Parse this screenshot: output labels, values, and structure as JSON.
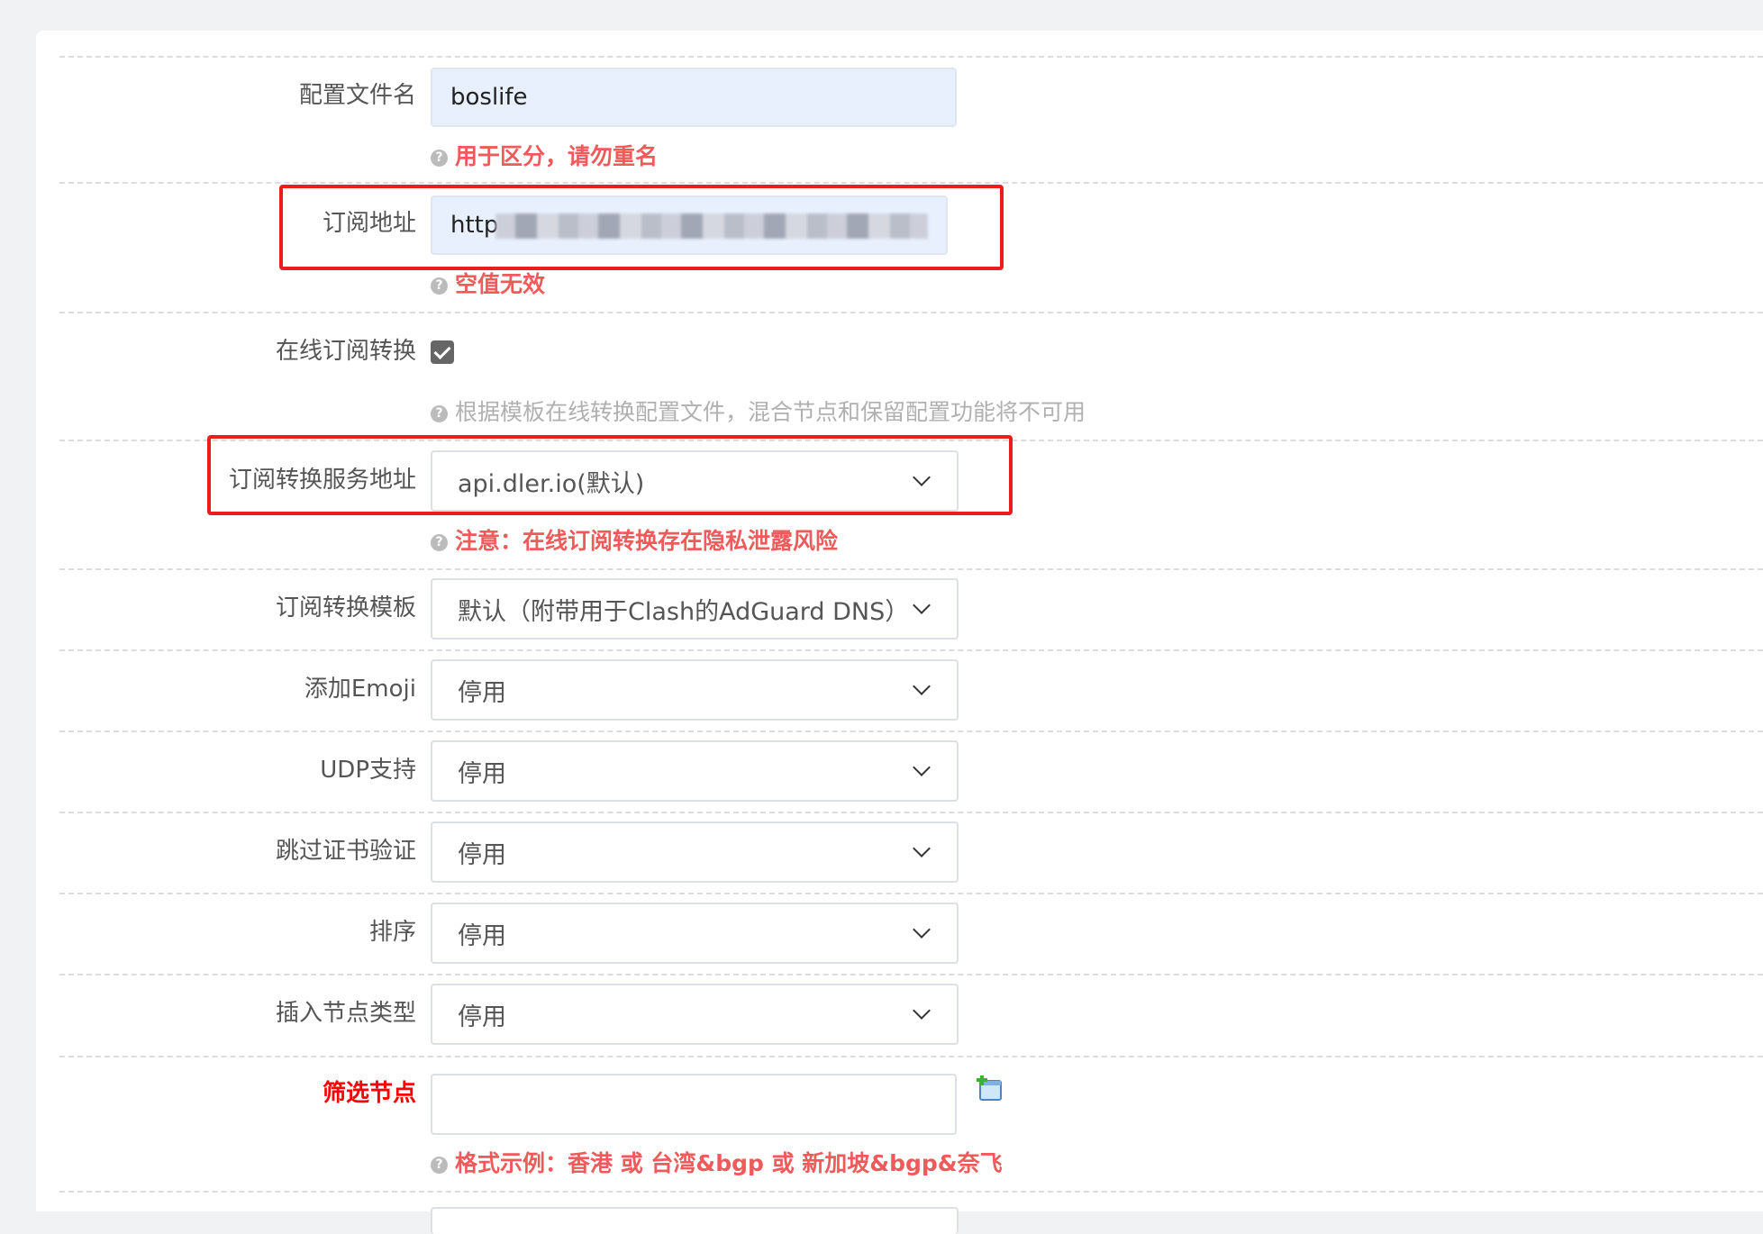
{
  "top_strip_text": "",
  "form": {
    "config_name": {
      "label": "配置文件名",
      "value": "boslife",
      "hint": "用于区分，请勿重名"
    },
    "sub_url": {
      "label": "订阅地址",
      "value": "http",
      "hint": "空值无效"
    },
    "online_convert": {
      "label": "在线订阅转换",
      "checked": true,
      "hint": "根据模板在线转换配置文件，混合节点和保留配置功能将不可用"
    },
    "convert_server": {
      "label": "订阅转换服务地址",
      "value": "api.dler.io(默认)",
      "hint": "注意：在线订阅转换存在隐私泄露风险"
    },
    "convert_template": {
      "label": "订阅转换模板",
      "value": "默认（附带用于Clash的AdGuard DNS）"
    },
    "add_emoji": {
      "label": "添加Emoji",
      "value": "停用"
    },
    "udp": {
      "label": "UDP支持",
      "value": "停用"
    },
    "skip_cert": {
      "label": "跳过证书验证",
      "value": "停用"
    },
    "sort": {
      "label": "排序",
      "value": "停用"
    },
    "node_type": {
      "label": "插入节点类型",
      "value": "停用"
    },
    "filter_nodes": {
      "label": "筛选节点",
      "value": "",
      "hint": "格式示例：香港 或 台湾&bgp 或 新加坡&bgp&奈飞"
    }
  },
  "icons": {
    "help": "question-circle-icon",
    "add": "add-item-icon",
    "checkbox": "checkmark-icon"
  },
  "colors": {
    "highlight": "#ee1c1c",
    "hint_red": "#f05a5a",
    "label_red": "#ff0000",
    "input_filled": "#e8f0fe"
  }
}
